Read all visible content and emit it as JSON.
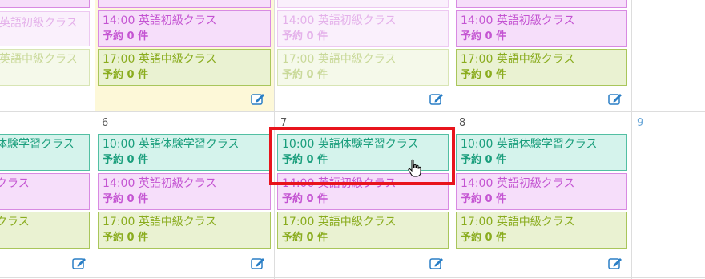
{
  "week1": {
    "events": {
      "col0": [
        {
          "text": "英語初級クラス",
          "count": "予約０件"
        },
        {
          "text": "英語中級クラス",
          "count": ""
        }
      ],
      "col1": [
        {
          "time": "14:00",
          "title": "英語初級クラス",
          "count": "予約 0 件"
        },
        {
          "time": "17:00",
          "title": "英語中級クラス",
          "count": "予約 0 件"
        }
      ],
      "col2": [
        {
          "time": "14:00",
          "title": "英語初級クラス",
          "count": "予約 0 件"
        },
        {
          "time": "17:00",
          "title": "英語中級クラス",
          "count": "予約 0 件"
        }
      ],
      "col3": [
        {
          "time": "14:00",
          "title": "英語初級クラス",
          "count": "予約 0 件"
        },
        {
          "time": "17:00",
          "title": "英語中級クラス",
          "count": "予約 0 件"
        }
      ]
    }
  },
  "week2": {
    "days": {
      "d6": "6",
      "d7": "7",
      "d8": "8",
      "d9": "9"
    },
    "events": {
      "col0": [
        {
          "title": "体験学習クラス"
        },
        {
          "title": "クラス"
        },
        {
          "title": "クラス"
        }
      ],
      "col1": [
        {
          "time": "10:00",
          "title": "英語体験学習クラス",
          "count": "予約 0 件"
        },
        {
          "time": "14:00",
          "title": "英語初級クラス",
          "count": "予約 0 件"
        },
        {
          "time": "17:00",
          "title": "英語中級クラス",
          "count": "予約 0 件"
        }
      ],
      "col2": [
        {
          "time": "10:00",
          "title": "英語体験学習クラス",
          "count": "予約 0 件"
        },
        {
          "time": "14:00",
          "title": "英語初級クラス",
          "count": "予約 0 件"
        },
        {
          "time": "17:00",
          "title": "英語中級クラス",
          "count": "予約 0 件"
        }
      ],
      "col3": [
        {
          "time": "10:00",
          "title": "英語体験学習クラス",
          "count": "予約 0 件"
        },
        {
          "time": "14:00",
          "title": "英語初級クラス",
          "count": "予約 0 件"
        },
        {
          "time": "17:00",
          "title": "英語中級クラス",
          "count": "予約 0 件"
        }
      ]
    }
  },
  "colors": {
    "trial": "#1a9e7c",
    "beginner": "#c454d2",
    "intermediate": "#8aac1e",
    "highlight": "#e8141c",
    "today": "#fdf8d8"
  }
}
